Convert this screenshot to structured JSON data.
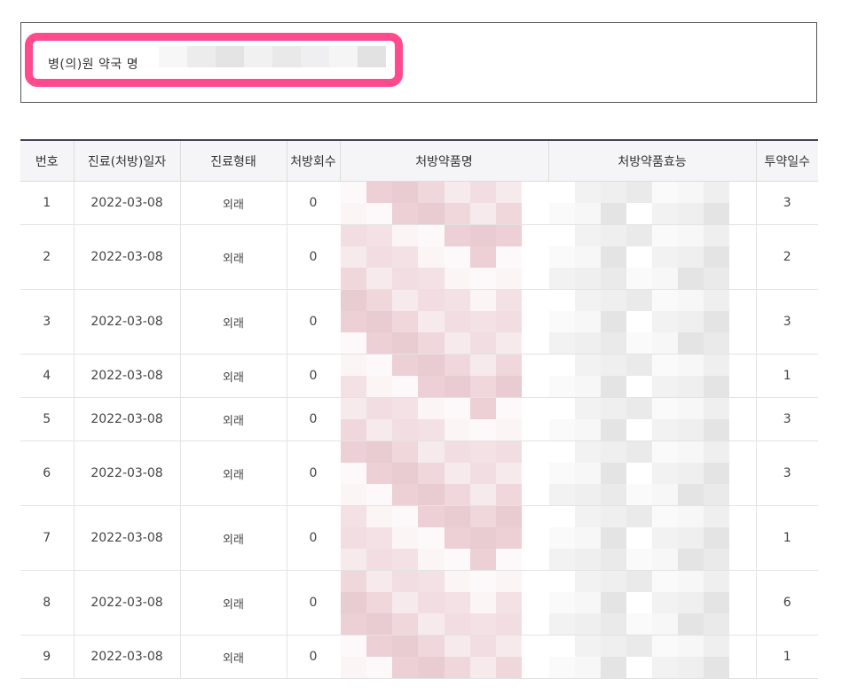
{
  "info": {
    "label": "병(의)원 약국 명"
  },
  "table": {
    "headers": [
      "번호",
      "진료(처방)일자",
      "진료형태",
      "처방회수",
      "처방약품명",
      "처방약품효능",
      "투약일수"
    ],
    "rows": [
      {
        "no": "1",
        "date": "2022-03-08",
        "type": "외래",
        "count": "0",
        "days": "3"
      },
      {
        "no": "2",
        "date": "2022-03-08",
        "type": "외래",
        "count": "0",
        "days": "2"
      },
      {
        "no": "3",
        "date": "2022-03-08",
        "type": "외래",
        "count": "0",
        "days": "3"
      },
      {
        "no": "4",
        "date": "2022-03-08",
        "type": "외래",
        "count": "0",
        "days": "1"
      },
      {
        "no": "5",
        "date": "2022-03-08",
        "type": "외래",
        "count": "0",
        "days": "3"
      },
      {
        "no": "6",
        "date": "2022-03-08",
        "type": "외래",
        "count": "0",
        "days": "3"
      },
      {
        "no": "7",
        "date": "2022-03-08",
        "type": "외래",
        "count": "0",
        "days": "1"
      },
      {
        "no": "8",
        "date": "2022-03-08",
        "type": "외래",
        "count": "0",
        "days": "6"
      },
      {
        "no": "9",
        "date": "2022-03-08",
        "type": "외래",
        "count": "0",
        "days": "1"
      }
    ]
  },
  "colors": {
    "highlight": "#ff4a8d",
    "header_bg": "#f5f5f7",
    "header_top_border": "#43445a",
    "redacted_drug": "#ecd3d8",
    "redacted_effect": "#e6e6e6"
  }
}
